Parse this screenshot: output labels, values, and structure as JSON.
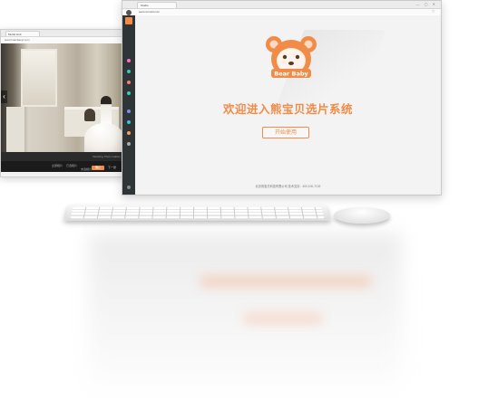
{
  "left_window": {
    "tab_label": "Model Hub",
    "url": "www.huanbaoyl.com",
    "carousel_prev_glyph": "‹",
    "photo_caption": "Wedding Photo Gallery",
    "footer_cells": [
      "全部相片",
      "已选相片",
      "未选相片"
    ],
    "confirm_button": "确认",
    "more_label": "下一张"
  },
  "main_window": {
    "tab_label": "Studio",
    "window_controls": "— ▢ ✕",
    "url": "www.xinruiid.com",
    "bookmark_icon": "star-icon",
    "sidebar": {
      "logo_icon": "logo-icon",
      "items": [
        {
          "icon": "dot-icon",
          "color": "#ff6ec7"
        },
        {
          "icon": "dot-icon",
          "color": "#3ac7b7"
        },
        {
          "icon": "dot-icon",
          "color": "#ff7a7a"
        },
        {
          "icon": "dot-icon",
          "color": "#2bd3b9"
        },
        {
          "icon": "dot-icon",
          "color": "#7f8cf8"
        },
        {
          "icon": "dot-icon",
          "color": "#37c4e6"
        },
        {
          "icon": "dot-icon",
          "color": "#ff9f5a"
        },
        {
          "icon": "dot-icon",
          "color": "#aaaaaa"
        },
        {
          "icon": "dot-icon",
          "color": "#888888"
        }
      ]
    },
    "logo_text": "Bear Baby",
    "welcome_title": "欢迎进入熊宝贝选片系统",
    "start_button": "开始使用",
    "footer_text": "北京熊宝贝科技有限公司 技术支持：400-100-7132"
  },
  "colors": {
    "accent": "#f08c47",
    "sidebar_bg": "#2f3436",
    "content_bg": "#f3f3f4"
  }
}
